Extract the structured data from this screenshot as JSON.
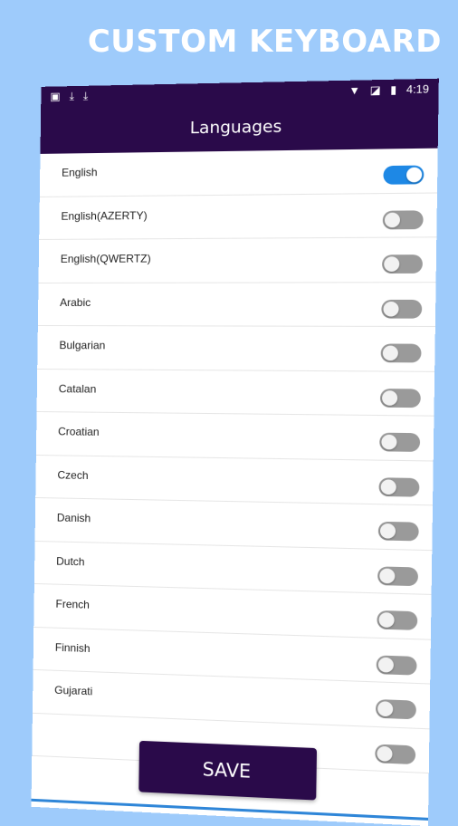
{
  "promo": {
    "title": "CUSTOM KEYBOARD"
  },
  "status_bar": {
    "time": "4:19",
    "left_icons": [
      "image-icon",
      "download-icon",
      "download-icon"
    ],
    "right_icons": [
      "wifi-icon",
      "signal-icon",
      "battery-icon"
    ]
  },
  "toolbar": {
    "title": "Languages"
  },
  "languages": [
    {
      "label": "English",
      "enabled": true
    },
    {
      "label": "English(AZERTY)",
      "enabled": false
    },
    {
      "label": "English(QWERTZ)",
      "enabled": false
    },
    {
      "label": "Arabic",
      "enabled": false
    },
    {
      "label": "Bulgarian",
      "enabled": false
    },
    {
      "label": "Catalan",
      "enabled": false
    },
    {
      "label": "Croatian",
      "enabled": false
    },
    {
      "label": "Czech",
      "enabled": false
    },
    {
      "label": "Danish",
      "enabled": false
    },
    {
      "label": "Dutch",
      "enabled": false
    },
    {
      "label": "French",
      "enabled": false
    },
    {
      "label": "Finnish",
      "enabled": false
    },
    {
      "label": "Gujarati",
      "enabled": false
    },
    {
      "label": "",
      "enabled": false
    }
  ],
  "actions": {
    "save_label": "SAVE"
  },
  "colors": {
    "primary": "#2a0a4a",
    "accent": "#1e88e5",
    "background": "#9ecbfb"
  }
}
